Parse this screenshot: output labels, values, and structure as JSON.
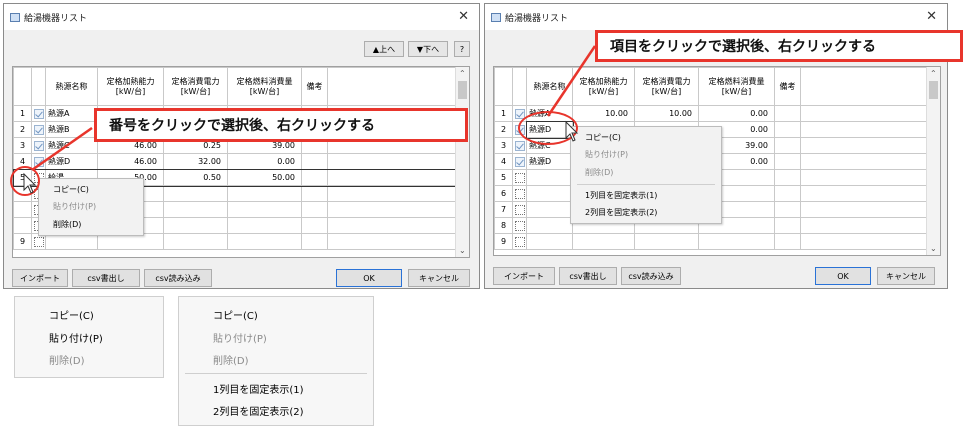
{
  "window_title": "給湯機器リスト",
  "toolbar": {
    "up_label": "▲上へ",
    "down_label": "▼下へ",
    "help_label": "?"
  },
  "columns": [
    "熱源名称",
    "定格加熱能力\n[kW/台]",
    "定格消費電力\n[kW/台]",
    "定格燃料消費量\n[kW/台]",
    "備考"
  ],
  "left_rows": [
    {
      "no": "1",
      "checked": true,
      "name": "熱源A",
      "heat": "",
      "power": "",
      "fuel": ""
    },
    {
      "no": "2",
      "checked": true,
      "name": "熱源B",
      "heat": "",
      "power": "",
      "fuel": ""
    },
    {
      "no": "3",
      "checked": true,
      "name": "熱源C",
      "heat": "46.00",
      "power": "0.25",
      "fuel": "39.00"
    },
    {
      "no": "4",
      "checked": true,
      "name": "熱源D",
      "heat": "46.00",
      "power": "32.00",
      "fuel": "0.00"
    },
    {
      "no": "5",
      "checked": false,
      "name": "給湯",
      "heat": "50.00",
      "power": "0.50",
      "fuel": "50.00"
    },
    {
      "no": "",
      "checked": false,
      "name": "",
      "heat": "",
      "power": "",
      "fuel": ""
    },
    {
      "no": "",
      "checked": false,
      "name": "",
      "heat": "",
      "power": "",
      "fuel": ""
    },
    {
      "no": "",
      "checked": false,
      "name": "",
      "heat": "",
      "power": "",
      "fuel": ""
    },
    {
      "no": "9",
      "checked": false,
      "name": "",
      "heat": "",
      "power": "",
      "fuel": ""
    }
  ],
  "right_rows": [
    {
      "no": "1",
      "checked": true,
      "name": "熱源A",
      "heat": "10.00",
      "power": "10.00",
      "fuel": "0.00"
    },
    {
      "no": "2",
      "checked": true,
      "name": "熱源D",
      "heat": "",
      "power": "",
      "fuel": "0.00"
    },
    {
      "no": "3",
      "checked": true,
      "name": "熱源C",
      "heat": "",
      "power": "",
      "fuel": "39.00"
    },
    {
      "no": "4",
      "checked": true,
      "name": "熱源D",
      "heat": "",
      "power": "",
      "fuel": "0.00"
    },
    {
      "no": "5",
      "checked": false,
      "name": "",
      "heat": "",
      "power": "",
      "fuel": ""
    },
    {
      "no": "6",
      "checked": false,
      "name": "",
      "heat": "",
      "power": "",
      "fuel": ""
    },
    {
      "no": "7",
      "checked": false,
      "name": "",
      "heat": "",
      "power": "",
      "fuel": ""
    },
    {
      "no": "8",
      "checked": false,
      "name": "",
      "heat": "",
      "power": "",
      "fuel": ""
    },
    {
      "no": "9",
      "checked": false,
      "name": "",
      "heat": "",
      "power": "",
      "fuel": ""
    }
  ],
  "buttons": {
    "import": "インポート",
    "csv_export": "csv書出し",
    "csv_import": "csv読み込み",
    "ok": "OK",
    "cancel": "キャンセル"
  },
  "callouts": {
    "left": "番号をクリックで選択後、右クリックする",
    "right": "項目をクリックで選択後、右クリックする"
  },
  "menu_row": {
    "copy": "コピー(C)",
    "paste": "貼り付け(P)",
    "delete": "削除(D)"
  },
  "menu_cell": {
    "copy": "コピー(C)",
    "paste": "貼り付け(P)",
    "delete": "削除(D)",
    "fix1": "1列目を固定表示(1)",
    "fix2": "2列目を固定表示(2)"
  },
  "colors": {
    "accent_red": "#e8352c",
    "window_bg": "#f0f0f0",
    "default_button_border": "#2a72d6"
  }
}
